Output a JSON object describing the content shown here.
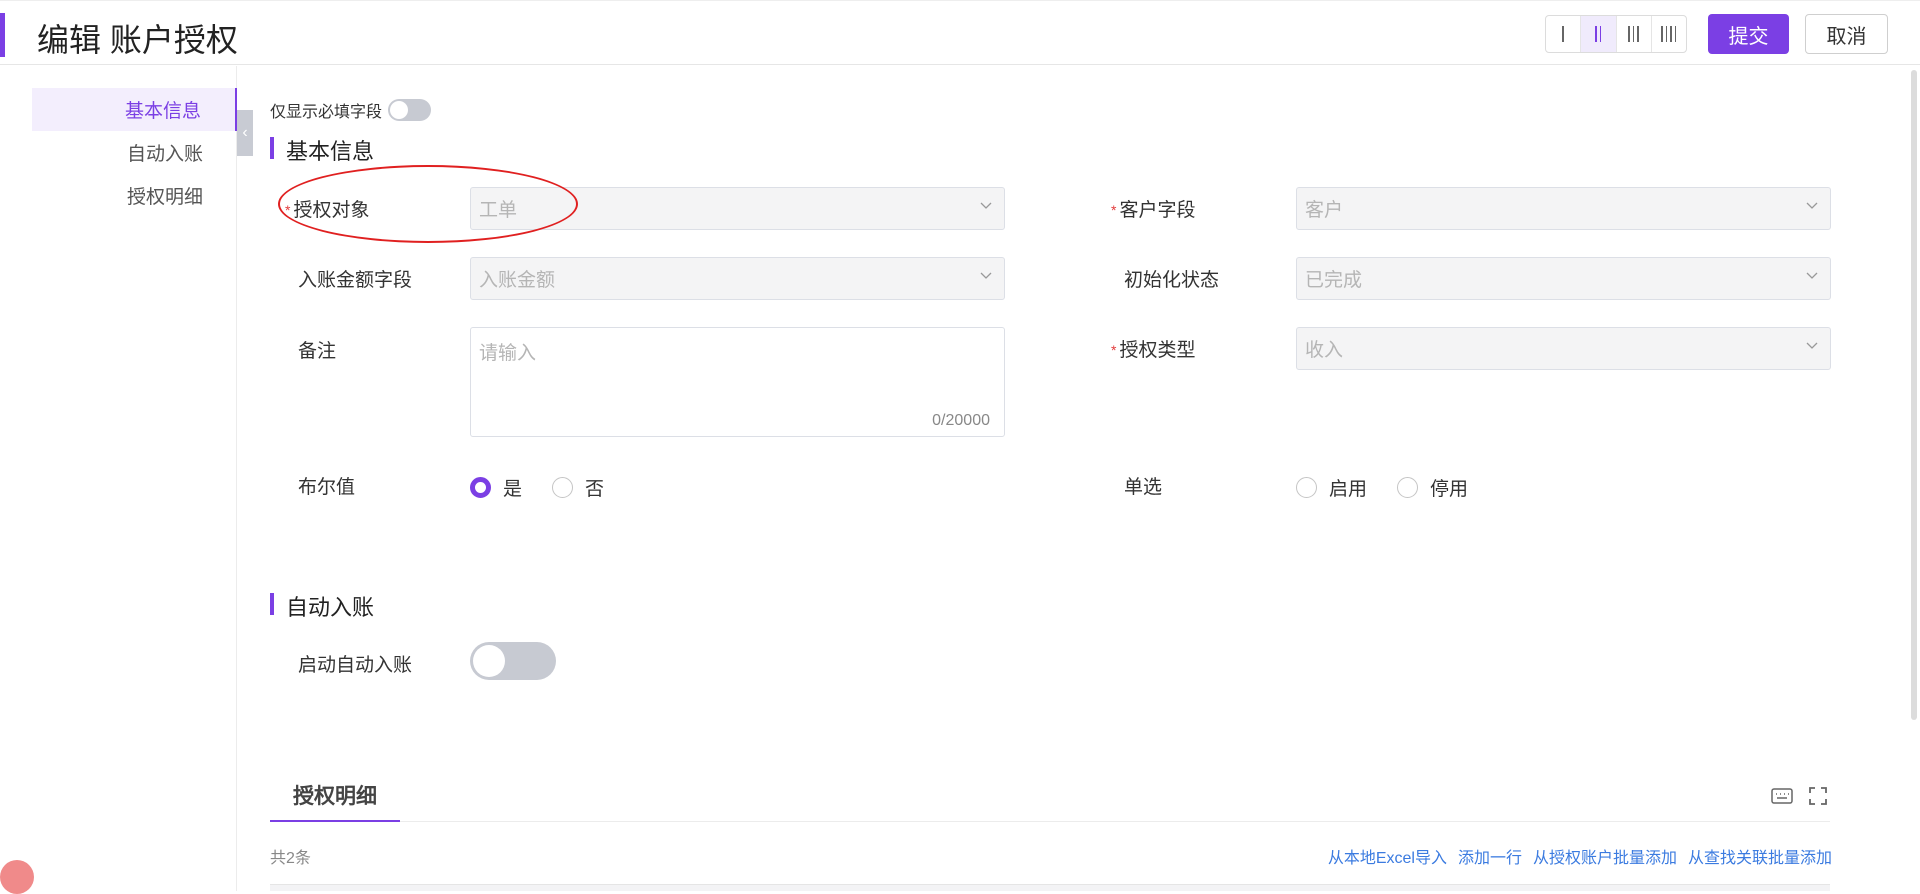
{
  "header": {
    "title": "编辑 账户授权",
    "submit": "提交",
    "cancel": "取消"
  },
  "nav": {
    "items": [
      "基本信息",
      "自动入账",
      "授权明细"
    ],
    "active": "基本信息"
  },
  "toggle": {
    "label": "仅显示必填字段"
  },
  "basic": {
    "title": "基本信息",
    "auth_object": {
      "label": "授权对象",
      "value": "工单"
    },
    "customer_field": {
      "label": "客户字段",
      "value": "客户"
    },
    "amount_field": {
      "label": "入账金额字段",
      "value": "入账金额"
    },
    "init_status": {
      "label": "初始化状态",
      "value": "已完成"
    },
    "remark": {
      "label": "备注",
      "placeholder": "请输入",
      "count": "0/20000"
    },
    "auth_type": {
      "label": "授权类型",
      "value": "收入"
    },
    "bool": {
      "label": "布尔值",
      "yes": "是",
      "no": "否",
      "selected": "是"
    },
    "single": {
      "label": "单选",
      "opt1": "启用",
      "opt2": "停用"
    }
  },
  "auto": {
    "title": "自动入账",
    "enable_label": "启动自动入账"
  },
  "detail": {
    "tab": "授权明细",
    "count": "共2条",
    "links": [
      "从本地Excel导入",
      "添加一行",
      "从授权账户批量添加",
      "从查找关联批量添加"
    ]
  },
  "colors": {
    "accent": "#7b3fe4",
    "required": "#e23b3b",
    "link": "#3b7be0"
  }
}
